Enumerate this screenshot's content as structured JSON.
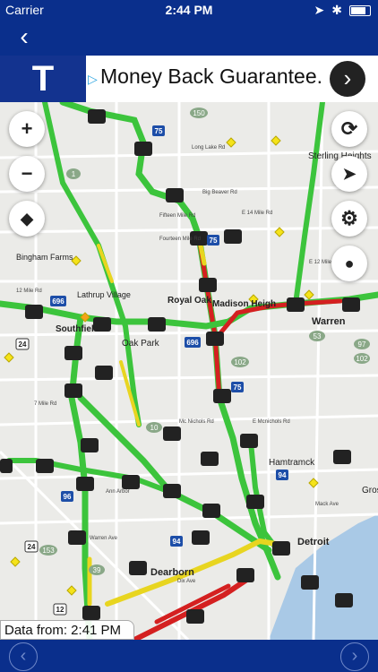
{
  "status": {
    "carrier": "Carrier",
    "time": "2:44 PM"
  },
  "nav": {
    "back_glyph": "‹"
  },
  "ad": {
    "logo": "T",
    "text": "Money Back Guarantee.",
    "arrow": "›"
  },
  "map_labels": {
    "sterling": "Sterling Heights",
    "royal_oak": "Royal Oak",
    "madison": "Madison Heigh",
    "southfield": "Southfield",
    "oak_park": "Oak Park",
    "bingham": "Bingham Farms",
    "lathrup": "Lathrup Village",
    "warren": "Warren",
    "hamtramck": "Hamtramck",
    "detroit": "Detroit",
    "dearborn": "Dearborn",
    "gross": "Gross-",
    "long_lake": "Long Lake Rd",
    "big_beaver": "Big Beaver Rd",
    "fifteen": "Fifteen Mile Rd",
    "fourteen": "Fourteen Mile Rd",
    "e14": "E 14 Mile Rd",
    "e12": "E 12 Mile Rd",
    "twelve": "12 Mile Rd",
    "seven": "7 Mile Rd",
    "mcnichols": "Mc Nichols Rd",
    "e_mcnichols": "E Mcnichols Rd",
    "warren_ave": "Warren Ave",
    "ann_arbor": "Ann Arbor",
    "mack": "Mack Ave",
    "dix": "Dix Ave"
  },
  "shields": {
    "s75a": "75",
    "s75b": "75",
    "s75c": "75",
    "s696a": "696",
    "s696b": "696",
    "s94a": "94",
    "s94b": "94",
    "s96": "96",
    "s24a": "24",
    "s24b": "24",
    "s10": "10",
    "s53": "53",
    "s97": "97",
    "s102": "102",
    "s150": "150",
    "s1": "1",
    "s39": "39",
    "s153": "153",
    "s12": "12"
  },
  "datafrom": "Data from: 2:41 PM",
  "pager": {
    "prev": "‹",
    "next": "›"
  },
  "colors": {
    "nav": "#0a2f8c",
    "green": "#3cc43c",
    "red": "#d42020",
    "yellow": "#e8d520"
  }
}
